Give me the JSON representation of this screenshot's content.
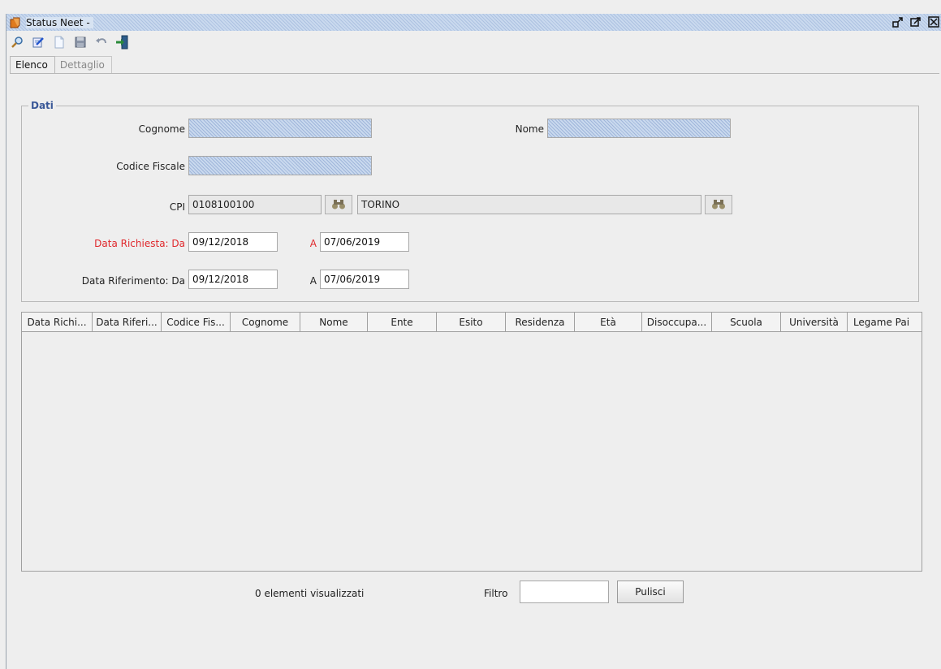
{
  "window": {
    "title": "Status Neet -"
  },
  "tabs": [
    {
      "label": "Elenco",
      "active": true
    },
    {
      "label": "Dettaglio",
      "active": false
    }
  ],
  "group": {
    "legend": "Dati"
  },
  "form": {
    "cognome_label": "Cognome",
    "cognome_value": "",
    "nome_label": "Nome",
    "nome_value": "",
    "codice_fiscale_label": "Codice Fiscale",
    "codice_fiscale_value": "",
    "cpi_label": "CPI",
    "cpi_code": "0108100100",
    "cpi_name": "TORINO",
    "data_richiesta_label": "Data Richiesta: Da",
    "data_richiesta_da": "09/12/2018",
    "data_richiesta_a_label": "A",
    "data_richiesta_a": "07/06/2019",
    "data_riferimento_label": "Data Riferimento: Da",
    "data_riferimento_da": "09/12/2018",
    "data_riferimento_a_label": "A",
    "data_riferimento_a": "07/06/2019"
  },
  "table": {
    "columns": [
      "Data Richi...",
      "Data Riferi...",
      "Codice Fis...",
      "Cognome",
      "Nome",
      "Ente",
      "Esito",
      "Residenza",
      "Età",
      "Disoccupa...",
      "Scuola",
      "Università",
      "Legame Pai"
    ],
    "rows": []
  },
  "footer": {
    "count_text": "0 elementi visualizzati",
    "filter_label": "Filtro",
    "filter_value": "",
    "clear_button": "Pulisci"
  },
  "colors": {
    "accent_red": "#e0282c",
    "legend_blue": "#3b5998",
    "background": "#eeeeee"
  }
}
